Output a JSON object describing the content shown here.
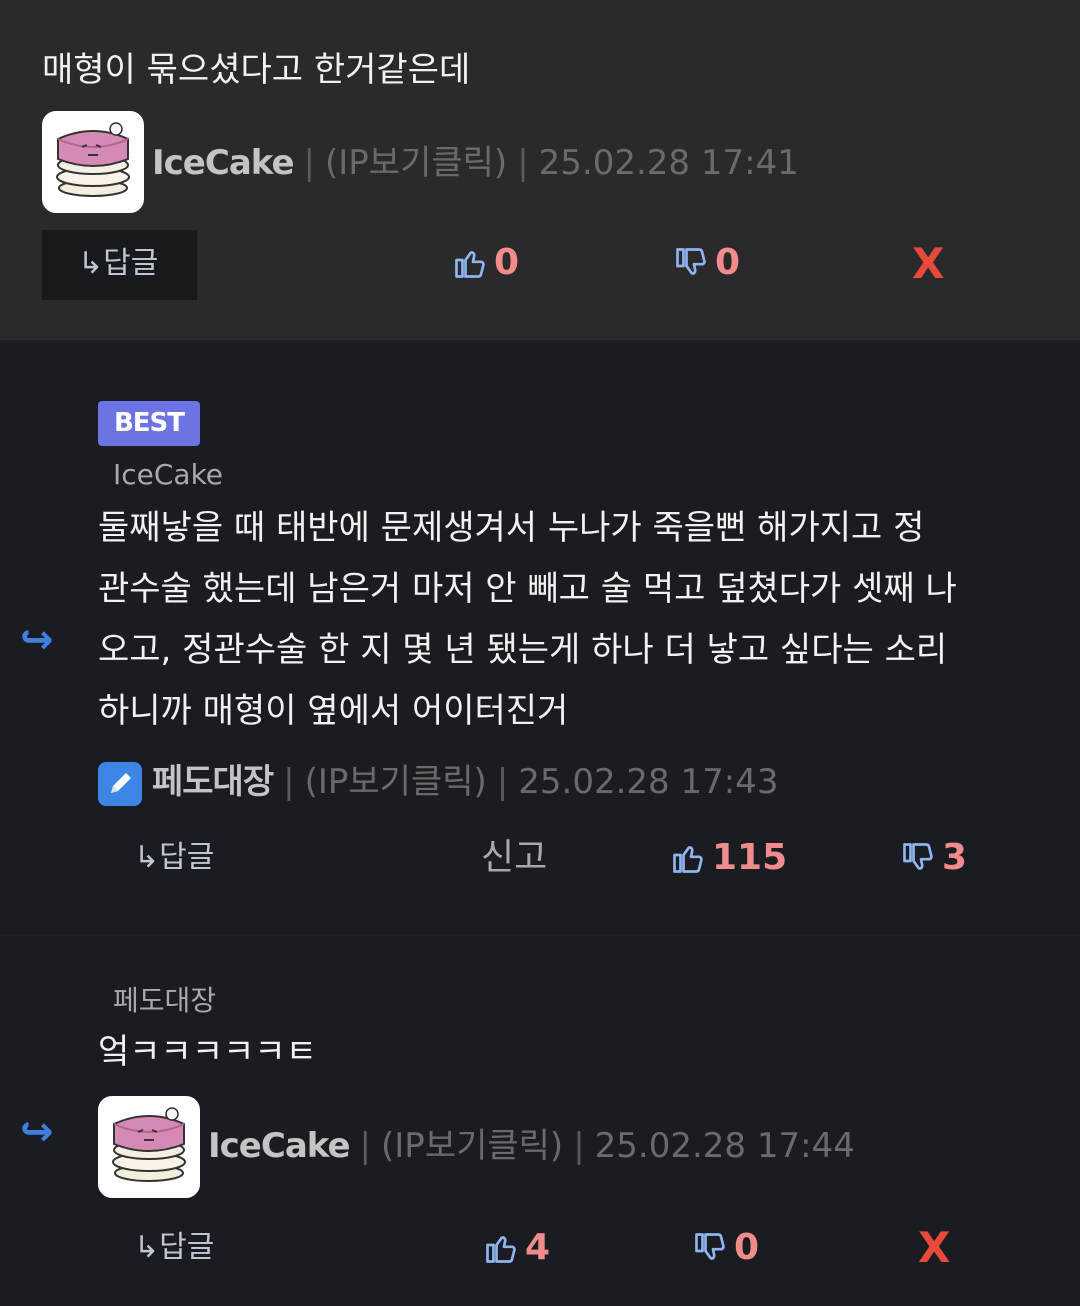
{
  "comment1": {
    "text": "매형이 묶으셨다고 한거같은데",
    "nickname": "IceCake",
    "ip_label": "(IP보기클릭)",
    "timestamp": "25.02.28 17:41",
    "reply_label": "답글",
    "likes": "0",
    "dislikes": "0",
    "delete_label": "X"
  },
  "comment2": {
    "badge": "BEST",
    "reply_to": "IceCake",
    "lines": [
      "둘째낳을 때 태반에 문제생겨서 누나가 죽을뻔 해가지고 정",
      "관수술 했는데 남은거 마저 안 빼고 술 먹고 덮쳤다가 셋째 나",
      "오고, 정관수술 한 지 몇 년 됐는게 하나 더 낳고 싶다는 소리",
      "하니까 매형이 옆에서 어이터진거"
    ],
    "nickname": "페도대장",
    "ip_label": "(IP보기클릭)",
    "timestamp": "25.02.28 17:43",
    "reply_label": "답글",
    "report_label": "신고",
    "likes": "115",
    "dislikes": "3"
  },
  "comment3": {
    "reply_to": "페도대장",
    "text": "엌ㅋㅋㅋㅋㅋㅌ",
    "nickname": "IceCake",
    "ip_label": "(IP보기클릭)",
    "timestamp": "25.02.28 17:44",
    "reply_label": "답글",
    "likes": "4",
    "dislikes": "0",
    "delete_label": "X"
  },
  "colors": {
    "vote_count": "#f28c8c",
    "thumb_icon": "#8fb4f0",
    "delete": "#e84a3a",
    "badge": "#6c74e4",
    "reply_arrow": "#3f7fe0"
  },
  "icons": {
    "like": "thumbs-up-icon",
    "dislike": "thumbs-down-icon",
    "reply": "reply-arrow-icon",
    "author": "pencil-icon"
  }
}
